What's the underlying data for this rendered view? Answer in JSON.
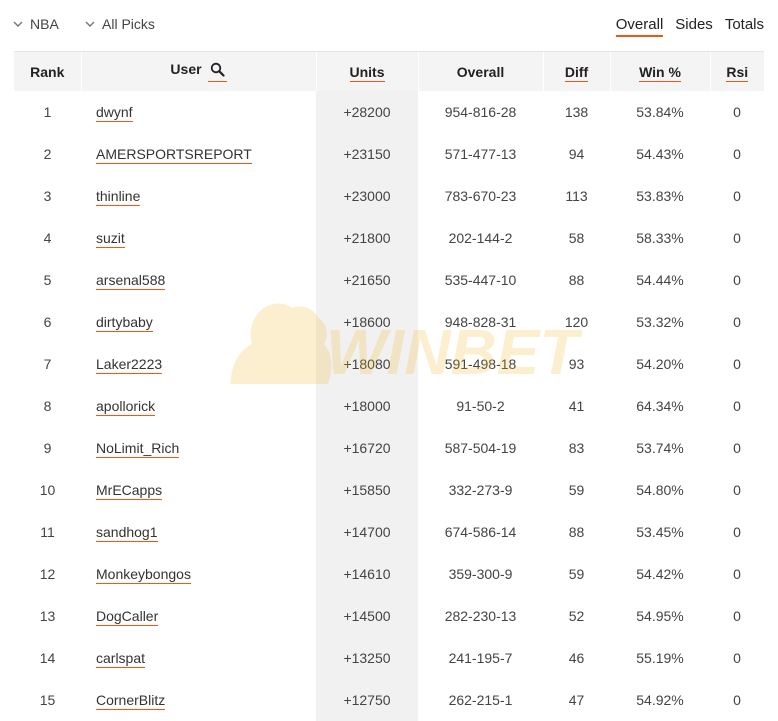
{
  "filters": {
    "sport": "NBA",
    "picks": "All Picks"
  },
  "views": [
    {
      "label": "Overall",
      "active": true
    },
    {
      "label": "Sides",
      "active": false
    },
    {
      "label": "Totals",
      "active": false
    }
  ],
  "columns": {
    "rank": "Rank",
    "user": "User",
    "units": "Units",
    "overall": "Overall",
    "diff": "Diff",
    "win": "Win %",
    "rsi": "Rsi"
  },
  "watermark_text": "WINBET",
  "rows": [
    {
      "rank": "1",
      "user": "dwynf",
      "units": "+28200",
      "overall": "954-816-28",
      "diff": "138",
      "win": "53.84%",
      "rsi": "0"
    },
    {
      "rank": "2",
      "user": "AMERSPORTSREPORT",
      "units": "+23150",
      "overall": "571-477-13",
      "diff": "94",
      "win": "54.43%",
      "rsi": "0"
    },
    {
      "rank": "3",
      "user": "thinline",
      "units": "+23000",
      "overall": "783-670-23",
      "diff": "113",
      "win": "53.83%",
      "rsi": "0"
    },
    {
      "rank": "4",
      "user": "suzit",
      "units": "+21800",
      "overall": "202-144-2",
      "diff": "58",
      "win": "58.33%",
      "rsi": "0"
    },
    {
      "rank": "5",
      "user": "arsenal588",
      "units": "+21650",
      "overall": "535-447-10",
      "diff": "88",
      "win": "54.44%",
      "rsi": "0"
    },
    {
      "rank": "6",
      "user": "dirtybaby",
      "units": "+18600",
      "overall": "948-828-31",
      "diff": "120",
      "win": "53.32%",
      "rsi": "0"
    },
    {
      "rank": "7",
      "user": "Laker2223",
      "units": "+18080",
      "overall": "591-498-18",
      "diff": "93",
      "win": "54.20%",
      "rsi": "0"
    },
    {
      "rank": "8",
      "user": "apollorick",
      "units": "+18000",
      "overall": "91-50-2",
      "diff": "41",
      "win": "64.34%",
      "rsi": "0"
    },
    {
      "rank": "9",
      "user": "NoLimit_Rich",
      "units": "+16720",
      "overall": "587-504-19",
      "diff": "83",
      "win": "53.74%",
      "rsi": "0"
    },
    {
      "rank": "10",
      "user": "MrECapps",
      "units": "+15850",
      "overall": "332-273-9",
      "diff": "59",
      "win": "54.80%",
      "rsi": "0"
    },
    {
      "rank": "11",
      "user": "sandhog1",
      "units": "+14700",
      "overall": "674-586-14",
      "diff": "88",
      "win": "53.45%",
      "rsi": "0"
    },
    {
      "rank": "12",
      "user": "Monkeybongos",
      "units": "+14610",
      "overall": "359-300-9",
      "diff": "59",
      "win": "54.42%",
      "rsi": "0"
    },
    {
      "rank": "13",
      "user": "DogCaller",
      "units": "+14500",
      "overall": "282-230-13",
      "diff": "52",
      "win": "54.95%",
      "rsi": "0"
    },
    {
      "rank": "14",
      "user": "carlspat",
      "units": "+13250",
      "overall": "241-195-7",
      "diff": "46",
      "win": "55.19%",
      "rsi": "0"
    },
    {
      "rank": "15",
      "user": "CornerBlitz",
      "units": "+12750",
      "overall": "262-215-1",
      "diff": "47",
      "win": "54.92%",
      "rsi": "0"
    }
  ]
}
